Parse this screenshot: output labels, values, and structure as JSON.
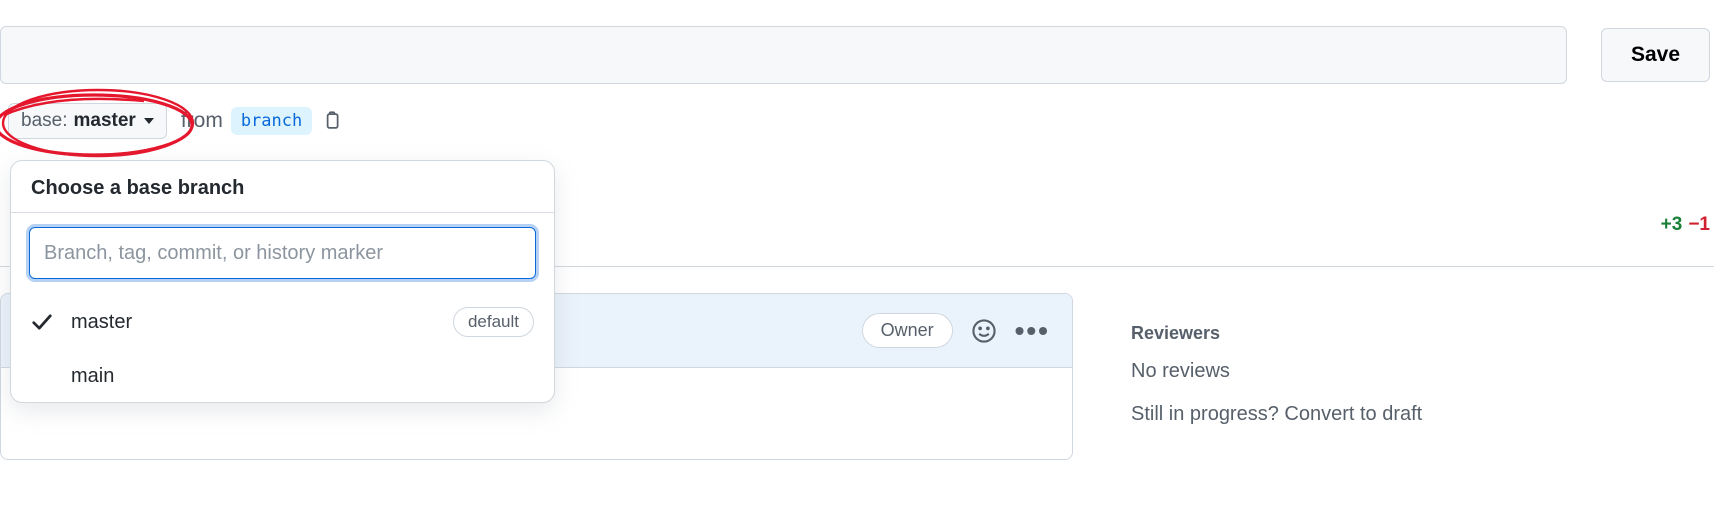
{
  "save_label": "Save",
  "base_selector": {
    "prefix": "base:",
    "value": "master"
  },
  "from_text": "from",
  "from_branch": "branch",
  "dropdown": {
    "title": "Choose a base branch",
    "search_placeholder": "Branch, tag, commit, or history marker",
    "items": [
      {
        "name": "master",
        "selected": true,
        "default": true
      },
      {
        "name": "main",
        "selected": false,
        "default": false
      }
    ],
    "default_label": "default"
  },
  "comment": {
    "owner_badge": "Owner"
  },
  "diffstat": {
    "additions": "+3",
    "deletions": "−1"
  },
  "sidebar": {
    "reviewers_heading": "Reviewers",
    "no_reviews": "No reviews",
    "convert_text": "Still in progress? Convert to draft"
  }
}
